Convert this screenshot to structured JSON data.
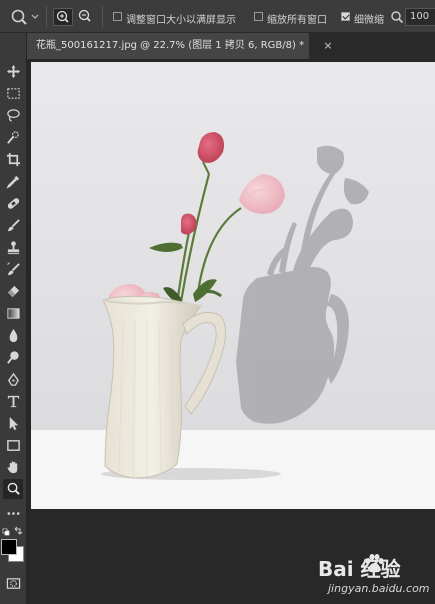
{
  "options_bar": {
    "zoom_in_tool": "zoom-in-icon",
    "zoom_out_tool": "zoom-out-icon",
    "checkboxes": [
      {
        "label": "调整窗口大小以满屏显示",
        "checked": false
      },
      {
        "label": "缩放所有窗口",
        "checked": false
      },
      {
        "label": "细微缩",
        "checked": true
      }
    ],
    "zoom_value": "100"
  },
  "document": {
    "tab_title": "花瓶_500161217.jpg @ 22.7% (图层 1 拷贝 6, RGB/8) *",
    "close_glyph": "×"
  },
  "toolbar": {
    "tools": [
      "move-icon",
      "marquee-icon",
      "lasso-icon",
      "quick-select-icon",
      "crop-icon",
      "eyedropper-icon",
      "healing-brush-icon",
      "brush-icon",
      "clone-stamp-icon",
      "history-brush-icon",
      "eraser-icon",
      "gradient-icon",
      "blur-icon",
      "dodge-icon",
      "pen-icon",
      "type-icon",
      "path-select-icon",
      "rectangle-icon",
      "hand-icon",
      "zoom-icon",
      "more-icon"
    ],
    "active_tool": "zoom-icon",
    "foreground_color": "#000000",
    "background_color": "#ffffff"
  },
  "watermark": {
    "brand": "Bai  经验",
    "url": "jingyan.baidu.com"
  },
  "colors": {
    "panel": "#3a3a3a",
    "options_bar": "#3c3c3c",
    "workspace": "#282828",
    "photo_wall": "#e4e4e6",
    "photo_table": "#f7f7f7"
  }
}
